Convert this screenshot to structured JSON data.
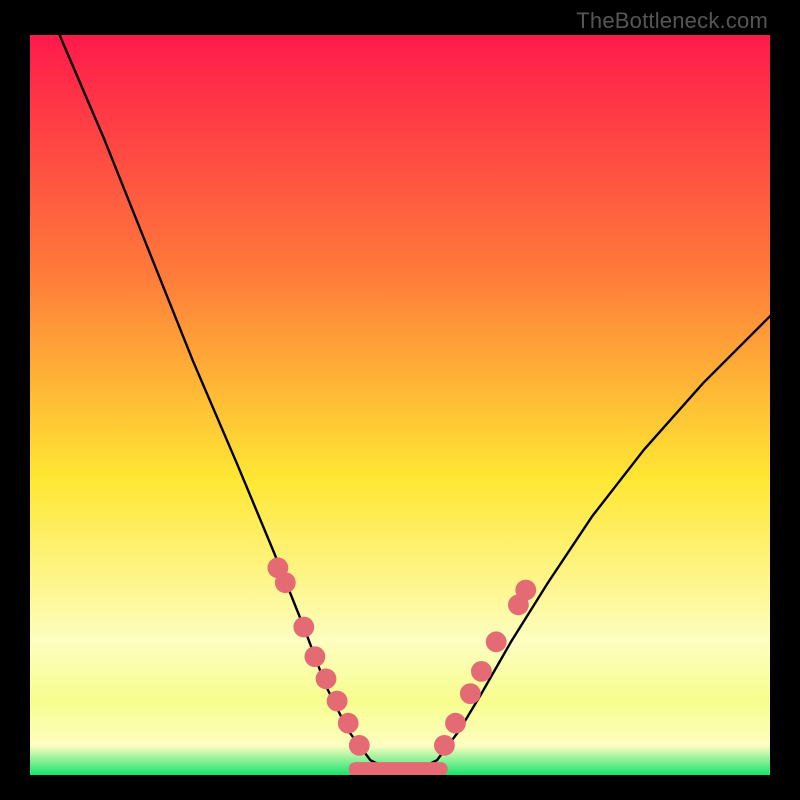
{
  "watermark": "TheBottleneck.com",
  "chart_data": {
    "type": "line",
    "title": "",
    "xlabel": "",
    "ylabel": "",
    "xlim": [
      0,
      100
    ],
    "ylim": [
      0,
      100
    ],
    "gradient_colors": {
      "top": "#ff1a4b",
      "mid_upper": "#ff7a3a",
      "mid": "#ffe733",
      "lower": "#fdfec0",
      "band": "#f7fe8e",
      "bottom": "#18e46d"
    },
    "curve_left": [
      {
        "x": 4.0,
        "y": 100.0
      },
      {
        "x": 10.0,
        "y": 86.0
      },
      {
        "x": 16.0,
        "y": 71.0
      },
      {
        "x": 22.0,
        "y": 56.0
      },
      {
        "x": 28.0,
        "y": 42.0
      },
      {
        "x": 33.0,
        "y": 30.0
      },
      {
        "x": 37.0,
        "y": 20.0
      },
      {
        "x": 40.0,
        "y": 12.0
      },
      {
        "x": 43.0,
        "y": 6.0
      },
      {
        "x": 46.0,
        "y": 2.0
      },
      {
        "x": 48.0,
        "y": 1.0
      }
    ],
    "curve_right": [
      {
        "x": 53.0,
        "y": 1.0
      },
      {
        "x": 55.0,
        "y": 2.0
      },
      {
        "x": 58.0,
        "y": 6.0
      },
      {
        "x": 61.0,
        "y": 11.0
      },
      {
        "x": 65.0,
        "y": 18.0
      },
      {
        "x": 70.0,
        "y": 26.0
      },
      {
        "x": 76.0,
        "y": 35.0
      },
      {
        "x": 83.0,
        "y": 44.0
      },
      {
        "x": 91.0,
        "y": 53.0
      },
      {
        "x": 100.0,
        "y": 62.0
      }
    ],
    "flat_bottom": {
      "x1": 46.0,
      "x2": 55.0,
      "y": 0.8
    },
    "markers_left": [
      {
        "x": 33.5,
        "y": 28.0
      },
      {
        "x": 34.5,
        "y": 26.0
      },
      {
        "x": 37.0,
        "y": 20.0
      },
      {
        "x": 38.5,
        "y": 16.0
      },
      {
        "x": 40.0,
        "y": 13.0
      },
      {
        "x": 41.5,
        "y": 10.0
      },
      {
        "x": 43.0,
        "y": 7.0
      },
      {
        "x": 44.5,
        "y": 4.0
      }
    ],
    "markers_right": [
      {
        "x": 56.0,
        "y": 4.0
      },
      {
        "x": 57.5,
        "y": 7.0
      },
      {
        "x": 59.5,
        "y": 11.0
      },
      {
        "x": 61.0,
        "y": 14.0
      },
      {
        "x": 63.0,
        "y": 18.0
      },
      {
        "x": 66.0,
        "y": 23.0
      },
      {
        "x": 67.0,
        "y": 25.0
      }
    ],
    "bottom_blob": {
      "x1": 44.0,
      "x2": 55.5,
      "y": 0.8
    },
    "marker_color": "#e46a73",
    "marker_radius": 1.4
  }
}
